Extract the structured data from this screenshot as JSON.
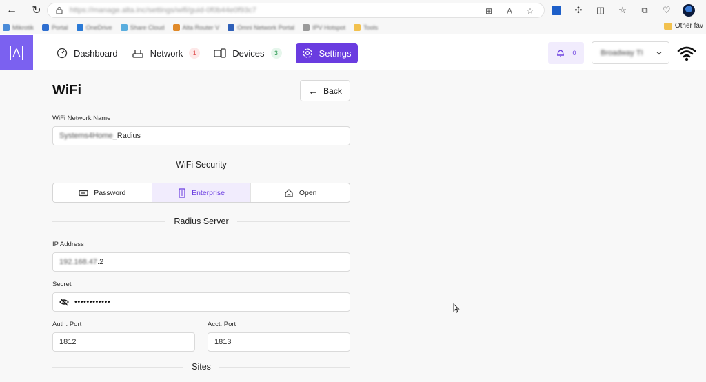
{
  "browser": {
    "url": "https://manage.alta.inc/settings/wifi/guid-0f0b44e0f93c7",
    "bookmarks": [
      "Mikrotik",
      "Portal",
      "OneDrive",
      "Share Cloud",
      "Alta Router V",
      "Omni Network Portal",
      "IPV Hotspot",
      "Tools"
    ],
    "other_favorites": "Other fav"
  },
  "header": {
    "logo": "[Λ]",
    "nav": [
      {
        "label": "Dashboard",
        "icon": "gauge-icon"
      },
      {
        "label": "Network",
        "icon": "router-icon",
        "badge": "1"
      },
      {
        "label": "Devices",
        "icon": "devices-icon",
        "badge": "3"
      },
      {
        "label": "Settings",
        "icon": "gear-icon",
        "active": true
      }
    ],
    "notifications_count": "0",
    "account_name": "Broadway TI"
  },
  "page": {
    "title": "WiFi",
    "back_label": "Back",
    "network_name_label": "WiFi Network Name",
    "network_name_value_blurred": "Systems4Home",
    "network_name_value_suffix": "_Radius",
    "security_heading": "WiFi Security",
    "security_options": [
      {
        "label": "Password",
        "icon": "keyboard-icon"
      },
      {
        "label": "Enterprise",
        "icon": "building-icon",
        "active": true
      },
      {
        "label": "Open",
        "icon": "home-icon"
      }
    ],
    "radius_heading": "Radius Server",
    "ip_label": "IP Address",
    "ip_value_blurred": "192.168.47",
    "ip_value_suffix": ".2",
    "secret_label": "Secret",
    "secret_value": "••••••••••••",
    "auth_port_label": "Auth. Port",
    "auth_port_value": "1812",
    "acct_port_label": "Acct. Port",
    "acct_port_value": "1813",
    "sites_heading": "Sites"
  },
  "colors": {
    "accent": "#6a3ce0",
    "logo_bg": "#7b61f0",
    "accent_soft": "#f1ecfd"
  }
}
